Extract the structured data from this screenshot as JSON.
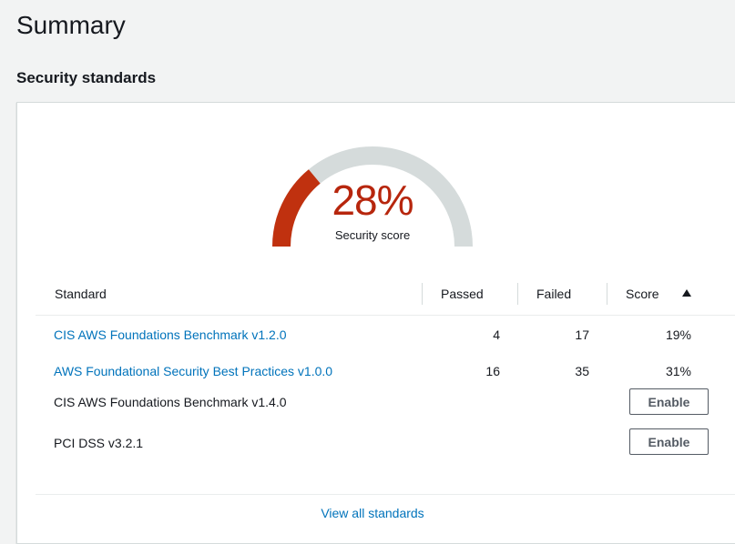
{
  "page": {
    "title": "Summary"
  },
  "section": {
    "title": "Security standards"
  },
  "score": {
    "percent_text": "28%",
    "value": 0.28,
    "label": "Security score",
    "fill_color": "#c0310f",
    "track_color": "#d5dbdb"
  },
  "table": {
    "headers": {
      "standard": "Standard",
      "passed": "Passed",
      "failed": "Failed",
      "score": "Score"
    },
    "rows": [
      {
        "name": "CIS AWS Foundations Benchmark v1.2.0",
        "passed": "4",
        "failed": "17",
        "score": "19%"
      },
      {
        "name": "AWS Foundational Security Best Practices v1.0.0",
        "passed": "16",
        "failed": "35",
        "score": "31%"
      },
      {
        "name": "CIS AWS Foundations Benchmark v1.4.0",
        "action": "Enable"
      },
      {
        "name": "PCI DSS v3.2.1",
        "action": "Enable"
      }
    ]
  },
  "footer": {
    "link": "View all standards"
  },
  "colors": {
    "link": "#0073bb",
    "score_red": "#b7260d"
  }
}
